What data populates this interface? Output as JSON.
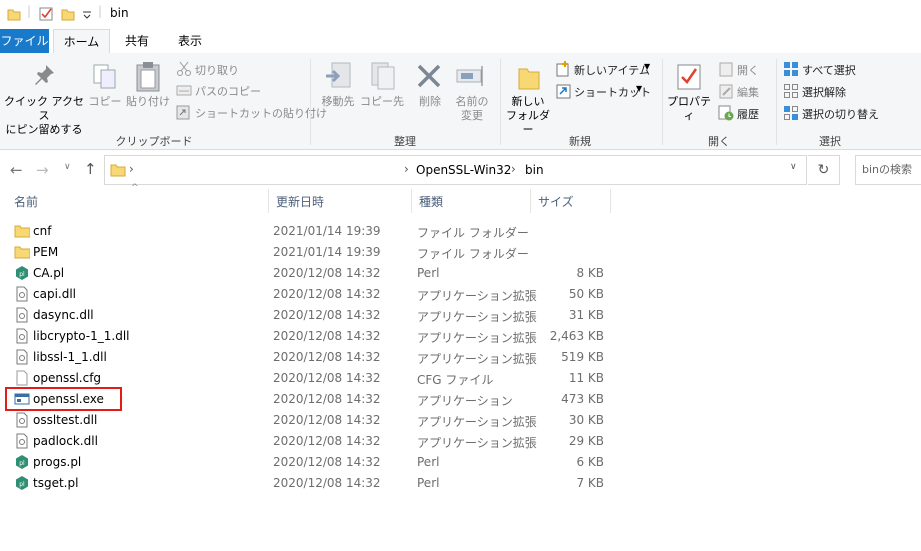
{
  "window": {
    "title": "bin"
  },
  "tabs": {
    "file": "ファイル",
    "home": "ホーム",
    "share": "共有",
    "view": "表示"
  },
  "ribbon": {
    "clipboard": {
      "pin_label_1": "クイック アクセス",
      "pin_label_2": "にピン留めする",
      "copy": "コピー",
      "paste": "貼り付け",
      "cut": "切り取り",
      "copy_path": "パスのコピー",
      "paste_shortcut": "ショートカットの貼り付け",
      "group": "クリップボード"
    },
    "organize": {
      "move_to": "移動先",
      "copy_to": "コピー先",
      "delete": "削除",
      "rename_1": "名前の",
      "rename_2": "変更",
      "group": "整理"
    },
    "new": {
      "new_folder_1": "新しい",
      "new_folder_2": "フォルダー",
      "new_item": "新しいアイテム",
      "shortcut": "ショートカット",
      "group": "新規"
    },
    "open": {
      "properties": "プロパティ",
      "open": "開く",
      "edit": "編集",
      "history": "履歴",
      "group": "開く"
    },
    "select": {
      "select_all": "すべて選択",
      "select_none": "選択解除",
      "invert": "選択の切り替え",
      "group": "選択"
    }
  },
  "address": {
    "breadcrumb": [
      "OpenSSL-Win32",
      "bin"
    ],
    "search_placeholder": "binの検索"
  },
  "columns": {
    "name": "名前",
    "date": "更新日時",
    "type": "種類",
    "size": "サイズ"
  },
  "files": [
    {
      "name": "cnf",
      "date": "2021/01/14 19:39",
      "type": "ファイル フォルダー",
      "size": "",
      "icon": "folder-icon"
    },
    {
      "name": "PEM",
      "date": "2021/01/14 19:39",
      "type": "ファイル フォルダー",
      "size": "",
      "icon": "folder-icon"
    },
    {
      "name": "CA.pl",
      "date": "2020/12/08 14:32",
      "type": "Perl",
      "size": "8 KB",
      "icon": "perl-icon"
    },
    {
      "name": "capi.dll",
      "date": "2020/12/08 14:32",
      "type": "アプリケーション拡張",
      "size": "50 KB",
      "icon": "dll-icon"
    },
    {
      "name": "dasync.dll",
      "date": "2020/12/08 14:32",
      "type": "アプリケーション拡張",
      "size": "31 KB",
      "icon": "dll-icon"
    },
    {
      "name": "libcrypto-1_1.dll",
      "date": "2020/12/08 14:32",
      "type": "アプリケーション拡張",
      "size": "2,463 KB",
      "icon": "dll-icon"
    },
    {
      "name": "libssl-1_1.dll",
      "date": "2020/12/08 14:32",
      "type": "アプリケーション拡張",
      "size": "519 KB",
      "icon": "dll-icon"
    },
    {
      "name": "openssl.cfg",
      "date": "2020/12/08 14:32",
      "type": "CFG ファイル",
      "size": "11 KB",
      "icon": "blank-file-icon"
    },
    {
      "name": "openssl.exe",
      "date": "2020/12/08 14:32",
      "type": "アプリケーション",
      "size": "473 KB",
      "icon": "exe-icon"
    },
    {
      "name": "ossltest.dll",
      "date": "2020/12/08 14:32",
      "type": "アプリケーション拡張",
      "size": "30 KB",
      "icon": "dll-icon"
    },
    {
      "name": "padlock.dll",
      "date": "2020/12/08 14:32",
      "type": "アプリケーション拡張",
      "size": "29 KB",
      "icon": "dll-icon"
    },
    {
      "name": "progs.pl",
      "date": "2020/12/08 14:32",
      "type": "Perl",
      "size": "6 KB",
      "icon": "perl-icon"
    },
    {
      "name": "tsget.pl",
      "date": "2020/12/08 14:32",
      "type": "Perl",
      "size": "7 KB",
      "icon": "perl-icon"
    }
  ],
  "highlighted_file": "openssl.exe",
  "colors": {
    "accent": "#1979ca",
    "highlight": "#e21b1b",
    "folder": "#f8d775"
  }
}
